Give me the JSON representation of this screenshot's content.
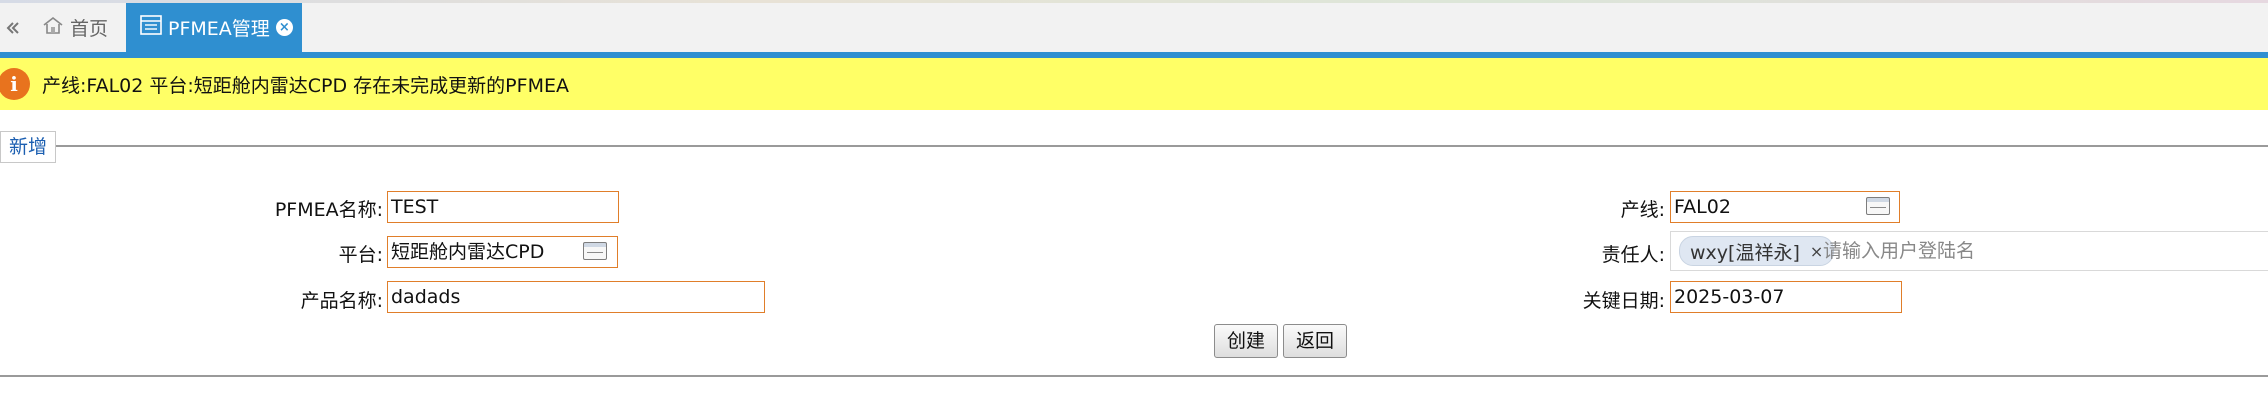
{
  "tabs": {
    "collapse_icon": "double-chevron-left-icon",
    "home_label": "首页",
    "home_icon": "home-icon",
    "active_label": "PFMEA管理",
    "active_icon": "table-icon",
    "close_icon": "close-circle-icon"
  },
  "alert": {
    "icon": "info-icon",
    "icon_text": "i",
    "text": "产线:FAL02 平台:短距舱内雷达CPD 存在未完成更新的PFMEA",
    "background": "#ffff66"
  },
  "section": {
    "legend": "新增"
  },
  "form": {
    "pfmea_name_label": "PFMEA名称:",
    "pfmea_name_value": "TEST",
    "platform_label": "平台:",
    "platform_value": "短距舱内雷达CPD",
    "product_name_label": "产品名称:",
    "product_name_value": "dadads",
    "line_label": "产线:",
    "line_value": "FAL02",
    "owner_label": "责任人:",
    "owner_chip": "wxy[温祥永]",
    "owner_chip_remove": "×",
    "owner_placeholder": "请输入用户登陆名",
    "key_date_label": "关键日期:",
    "key_date_value": "2025-03-07"
  },
  "buttons": {
    "create": "创建",
    "back": "返回"
  },
  "colors": {
    "accent": "#2f8fd0",
    "field_border": "#e07e2a",
    "legend_text": "#1c5fb1"
  }
}
